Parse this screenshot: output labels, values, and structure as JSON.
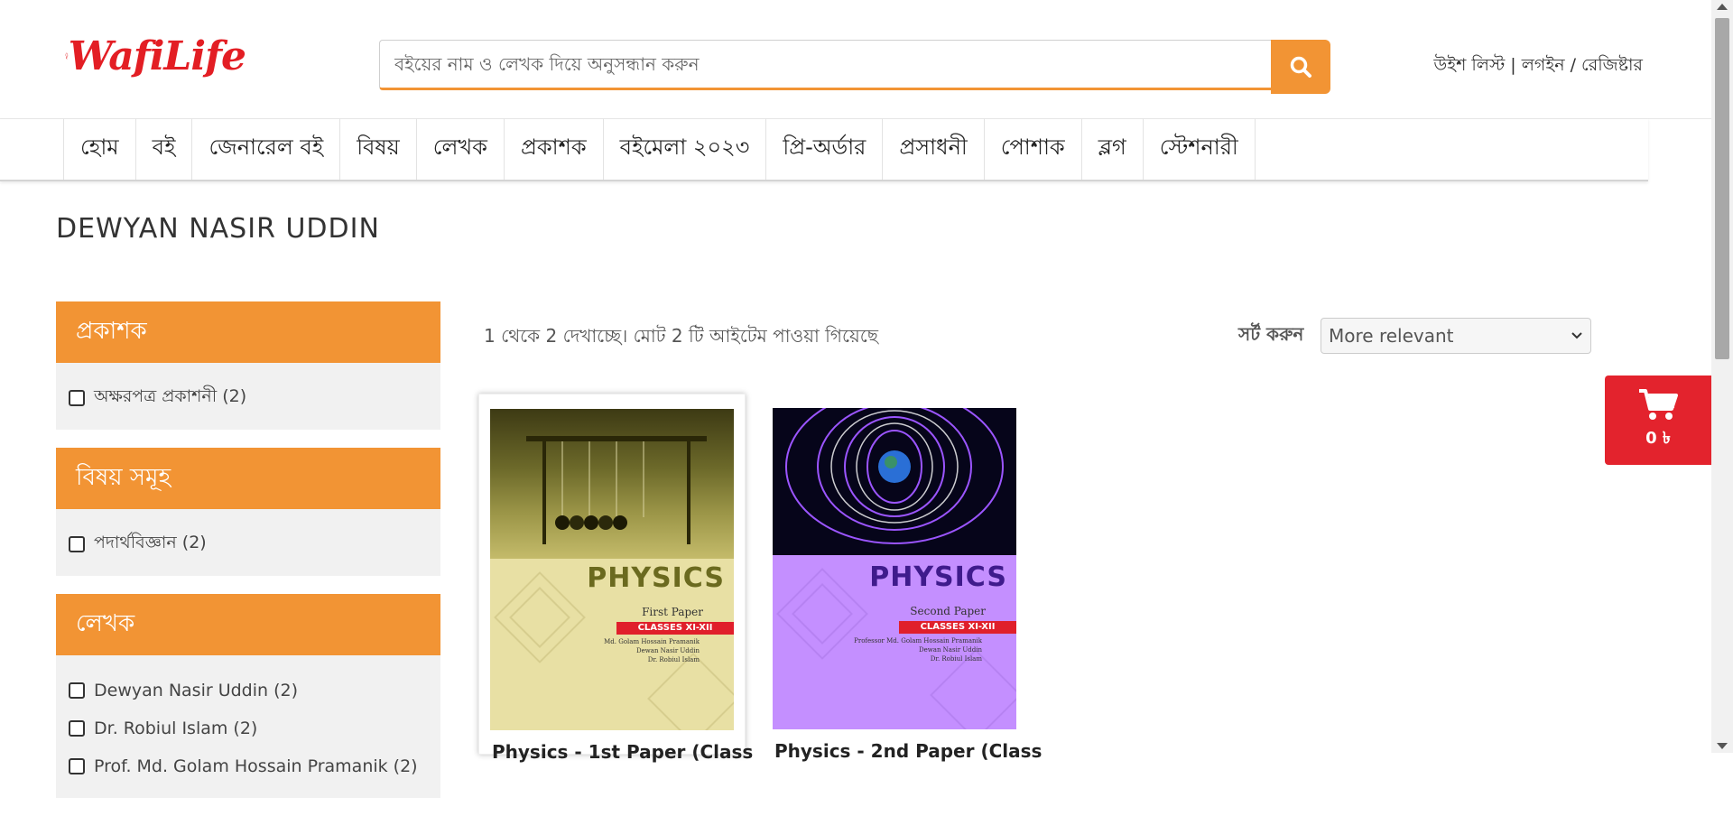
{
  "header": {
    "logo_text": "WafiLife",
    "search": {
      "placeholder": "বইয়ের নাম ও লেখক দিয়ে অনুসন্ধান করুন",
      "value": ""
    },
    "user_links": {
      "wishlist": "উইশ লিস্ট",
      "login": "লগইন",
      "register": "রেজিষ্টার"
    }
  },
  "nav": {
    "items": [
      "হোম",
      "বই",
      "জেনারেল বই",
      "বিষয়",
      "লেখক",
      "প্রকাশক",
      "বইমেলা ২০২৩",
      "প্রি-অর্ডার",
      "প্রসাধনী",
      "পোশাক",
      "ব্লগ",
      "স্টেশনারী"
    ]
  },
  "page": {
    "title": "DEWYAN NASIR UDDIN"
  },
  "sidebar": {
    "facets": [
      {
        "title": "প্রকাশক",
        "options": [
          "অক্ষরপত্র প্রকাশনী (2)"
        ]
      },
      {
        "title": "বিষয় সমূহ",
        "options": [
          "পদার্থবিজ্ঞান (2)"
        ]
      },
      {
        "title": "লেখক",
        "options": [
          "Dewyan Nasir Uddin (2)",
          "Dr. Robiul Islam (2)",
          "Prof. Md. Golam Hossain Pramanik (2)"
        ]
      }
    ]
  },
  "results": {
    "count_text": "1 থেকে 2 দেখাচ্ছে। মোট 2 টি আইটেম পাওয়া গিয়েছে",
    "sort_label": "সর্ট করুন",
    "sort_value": "More relevant"
  },
  "products": [
    {
      "title": "Physics - 1st Paper (Class",
      "cover": {
        "heading": "PHYSICS",
        "paper": "First Paper",
        "classes": "CLASSES XI-XII",
        "authors": [
          "Md. Golam Hossain Pramanik",
          "Dewan Nasir Uddin",
          "Dr. Robiul Islam"
        ]
      }
    },
    {
      "title": "Physics - 2nd Paper (Class",
      "cover": {
        "heading": "PHYSICS",
        "paper": "Second Paper",
        "classes": "CLASSES XI-XII",
        "authors": [
          "Professor Md. Golam Hossain Pramanik",
          "Dewan Nasir Uddin",
          "Dr. Robiul Islam"
        ]
      }
    }
  ],
  "cart": {
    "amount": "0 ৳",
    "icon": "shopping-cart-icon"
  },
  "colors": {
    "accent": "#f29434",
    "brand_red": "#e3232d"
  }
}
